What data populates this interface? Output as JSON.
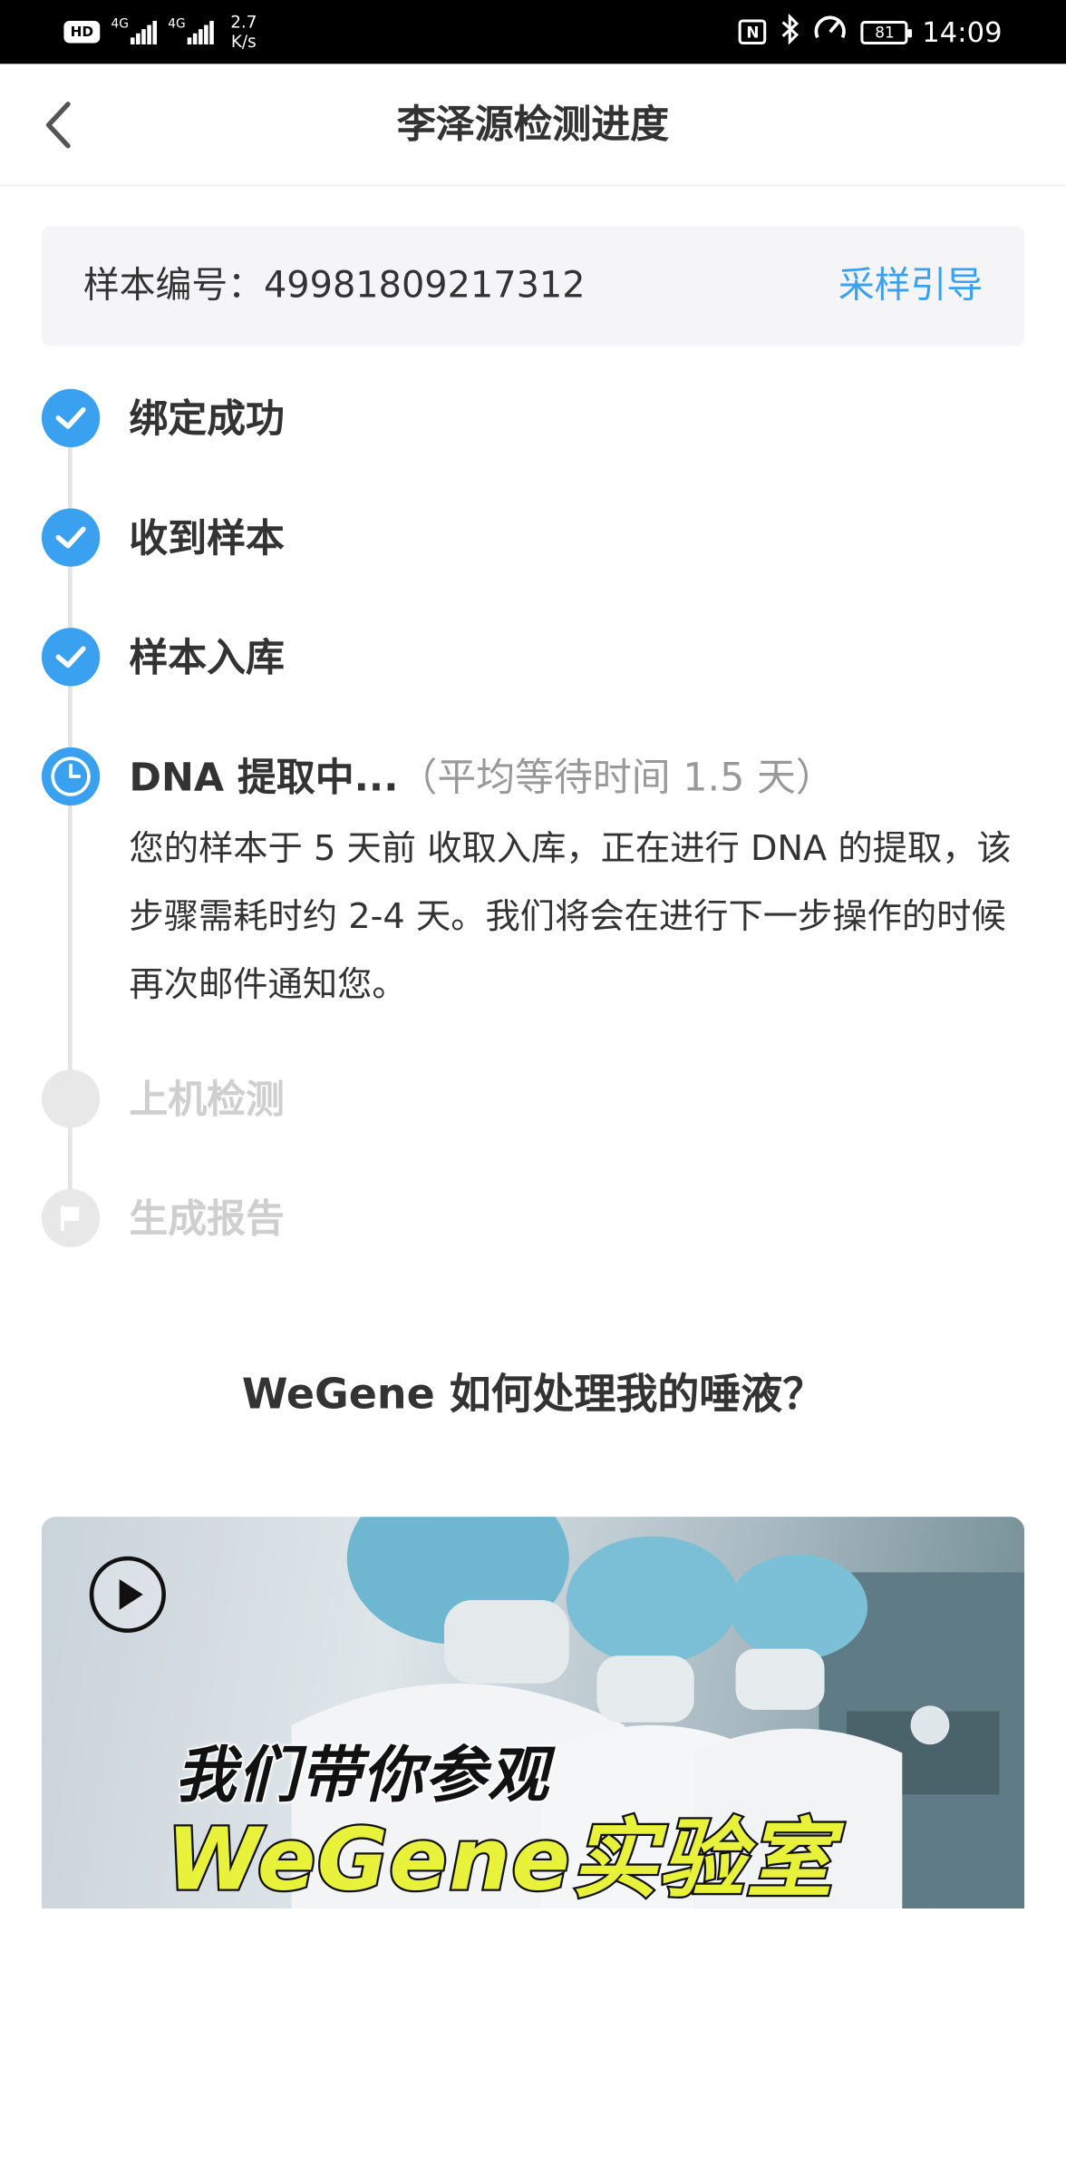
{
  "status_bar": {
    "hd_label": "HD",
    "sim1_label": "4G",
    "sim2_label": "4G",
    "speed_value": "2.7",
    "speed_unit": "K/s",
    "nfc_label": "N",
    "battery": "81",
    "time": "14:09"
  },
  "nav": {
    "title": "李泽源检测进度"
  },
  "sample": {
    "label": "样本编号：",
    "number": "49981809217312",
    "guide_link": "采样引导"
  },
  "steps": [
    {
      "label": "绑定成功",
      "status": "done"
    },
    {
      "label": "收到样本",
      "status": "done"
    },
    {
      "label": "样本入库",
      "status": "done"
    },
    {
      "label": "DNA 提取中...",
      "note": "（平均等待时间 1.5 天）",
      "status": "active",
      "description": "您的样本于 5 天前 收取入库，正在进行 DNA 的提取，该步骤需耗时约 2-4 天。我们将会在进行下一步操作的时候再次邮件通知您。"
    },
    {
      "label": "上机检测",
      "status": "pending"
    },
    {
      "label": "生成报告",
      "status": "pending"
    }
  ],
  "video": {
    "section_title": "WeGene 如何处理我的唾液？",
    "headline_line1": "我们带你参观",
    "headline_line2": "WeGene实验室"
  },
  "colors": {
    "accent": "#3aa0f0",
    "pending": "#e8e8e8",
    "headline_yellow": "#e8f23a"
  },
  "icons": {
    "back": "chevron-left-icon",
    "done": "check-icon",
    "active": "clock-icon",
    "pending_last": "flag-icon",
    "play": "play-icon"
  }
}
